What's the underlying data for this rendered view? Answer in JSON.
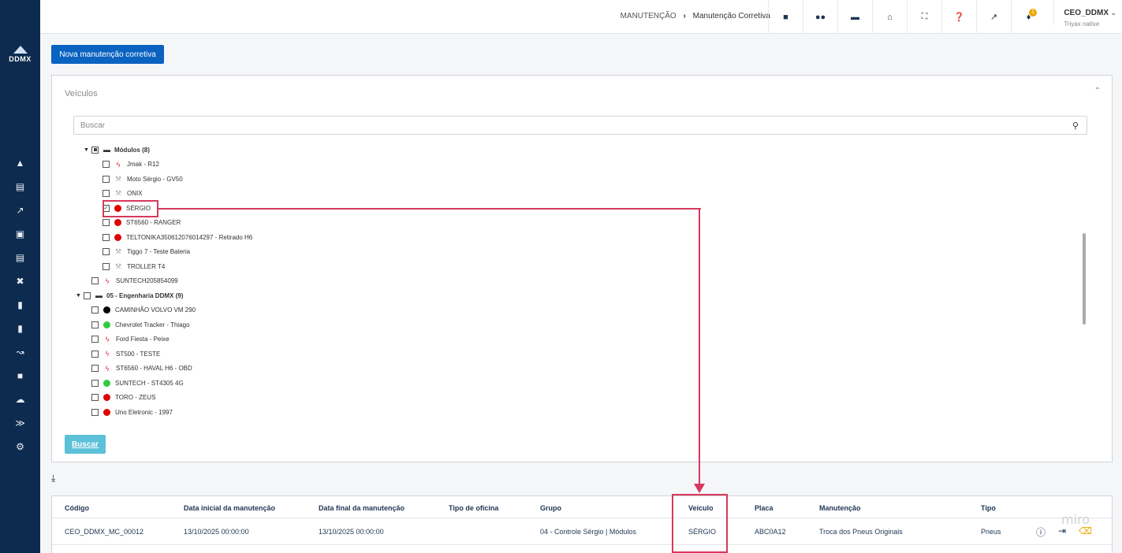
{
  "sidebar": {
    "logo_text": "DDMX",
    "icons": [
      "car-icon",
      "card-icon",
      "chart-line-icon",
      "file-icon",
      "list-icon",
      "wrench-icon",
      "document-icon",
      "page-icon",
      "route-icon",
      "shield-icon",
      "cloud-icon",
      "terminal-icon",
      "gears-icon"
    ]
  },
  "topbar": {
    "breadcrumb_parent": "MANUTENÇÃO",
    "breadcrumb_current": "Manutenção Corretiva",
    "notification_count": "1",
    "user_name": "CEO_DDMX",
    "user_sub": "Triyax native"
  },
  "actions": {
    "new_button": "Nova manutenção corretiva"
  },
  "vehicles_panel": {
    "title": "Veículos",
    "search_placeholder": "Buscar",
    "search_button": "Buscar",
    "tree": [
      {
        "label": "Módulos (8)",
        "level": 1,
        "folder": true,
        "state": "partial"
      },
      {
        "label": "Jmak - R12",
        "level": 2,
        "icon": "bolt",
        "state": "unchecked"
      },
      {
        "label": "Moto Sérgio - GV50",
        "level": 2,
        "icon": "wrench",
        "state": "unchecked"
      },
      {
        "label": "ONIX",
        "level": 2,
        "icon": "wrench",
        "state": "unchecked"
      },
      {
        "label": "SÉRGIO",
        "level": 2,
        "icon": "red",
        "state": "checked"
      },
      {
        "label": "ST6560 - RANGER",
        "level": 2,
        "icon": "red",
        "state": "unchecked"
      },
      {
        "label": "TELTONIKA350612076014297 - Retirado H6",
        "level": 2,
        "icon": "red",
        "state": "unchecked"
      },
      {
        "label": "Tiggo 7 - Teste Bateria",
        "level": 2,
        "icon": "wrench",
        "state": "unchecked"
      },
      {
        "label": "TROLLER T4",
        "level": 2,
        "icon": "wrench",
        "state": "unchecked"
      },
      {
        "label": "SUNTECH205854099",
        "level": 1,
        "icon": "bolt",
        "state": "unchecked"
      },
      {
        "label": "05 - Engenharia DDMX (9)",
        "level": 0,
        "folder": true,
        "state": "unchecked"
      },
      {
        "label": "CAMINHÃO VOLVO VM 290",
        "level": 1,
        "icon": "black",
        "state": "unchecked"
      },
      {
        "label": "Chevrolet Tracker - Thiago",
        "level": 1,
        "icon": "green",
        "state": "unchecked"
      },
      {
        "label": "Ford Fiesta - Peixe",
        "level": 1,
        "icon": "bolt",
        "state": "unchecked"
      },
      {
        "label": "ST500 - TESTE",
        "level": 1,
        "icon": "bolt",
        "state": "unchecked"
      },
      {
        "label": "ST6560 - HAVAL H6 - OBD",
        "level": 1,
        "icon": "bolt",
        "state": "unchecked"
      },
      {
        "label": "SUNTECH - ST4305 4G",
        "level": 1,
        "icon": "green",
        "state": "unchecked"
      },
      {
        "label": "TORO - ZEUS",
        "level": 1,
        "icon": "red",
        "state": "unchecked"
      },
      {
        "label": "Uno Eletronic - 1997",
        "level": 1,
        "icon": "red",
        "state": "unchecked"
      }
    ]
  },
  "table": {
    "headers": [
      "Código",
      "Data inicial da manutenção",
      "Data final da manutenção",
      "Tipo de oficina",
      "Grupo",
      "Veículo",
      "Placa",
      "Manutenção",
      "Tipo"
    ],
    "rows": [
      [
        "CEO_DDMX_MC_00012",
        "13/10/2025 00:00:00",
        "13/10/2025 00:00:00",
        "",
        "04 - Controle Sérgio | Módulos",
        "SÉRGIO",
        "ABC0A12",
        "Troca dos Pneus Originais",
        "Pneus"
      ]
    ]
  },
  "watermark": "miro",
  "colors": {
    "sidebar": "#0d2b4e",
    "primary": "#0b63c1",
    "search_button": "#5bc0d8",
    "highlight": "#d6395c",
    "status_red": "#e00000",
    "status_green": "#2ecc40",
    "status_black": "#000000",
    "bolt": "#e5243b"
  }
}
